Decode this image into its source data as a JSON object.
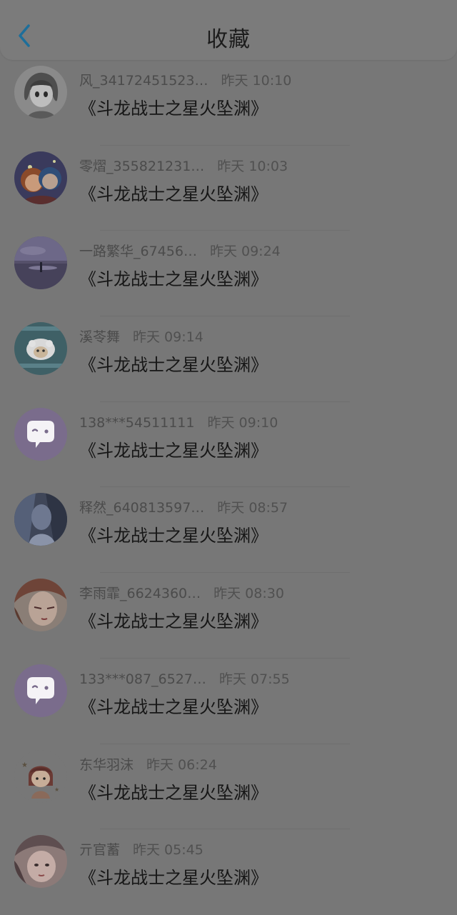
{
  "header": {
    "title": "收藏"
  },
  "items": [
    {
      "user": "风_34172451523…",
      "time": "昨天 10:10",
      "book": "《斗龙战士之星火坠渊》",
      "avatar": "anime-boy"
    },
    {
      "user": "零熠_355821231…",
      "time": "昨天 10:03",
      "book": "《斗龙战士之星火坠渊》",
      "avatar": "cartoon-duo"
    },
    {
      "user": "一路繁华_67456…",
      "time": "昨天 09:24",
      "book": "《斗龙战士之星火坠渊》",
      "avatar": "night-scene"
    },
    {
      "user": "溪苓舞",
      "time": "昨天 09:14",
      "book": "《斗龙战士之星火坠渊》",
      "avatar": "sheep"
    },
    {
      "user": "138***54511111",
      "time": "昨天 09:10",
      "book": "《斗龙战士之星火坠渊》",
      "avatar": "default-bubble"
    },
    {
      "user": "释然_640813597…",
      "time": "昨天 08:57",
      "book": "《斗龙战士之星火坠渊》",
      "avatar": "dark-photo"
    },
    {
      "user": "李雨霏_6624360…",
      "time": "昨天 08:30",
      "book": "《斗龙战士之星火坠渊》",
      "avatar": "anime-girl"
    },
    {
      "user": "133***087_6527…",
      "time": "昨天 07:55",
      "book": "《斗龙战士之星火坠渊》",
      "avatar": "default-bubble"
    },
    {
      "user": "东华羽沫",
      "time": "昨天 06:24",
      "book": "《斗龙战士之星火坠渊》",
      "avatar": "chibi-girl"
    },
    {
      "user": "亓官蓄",
      "time": "昨天 05:45",
      "book": "《斗龙战士之星火坠渊》",
      "avatar": "portrait"
    }
  ]
}
